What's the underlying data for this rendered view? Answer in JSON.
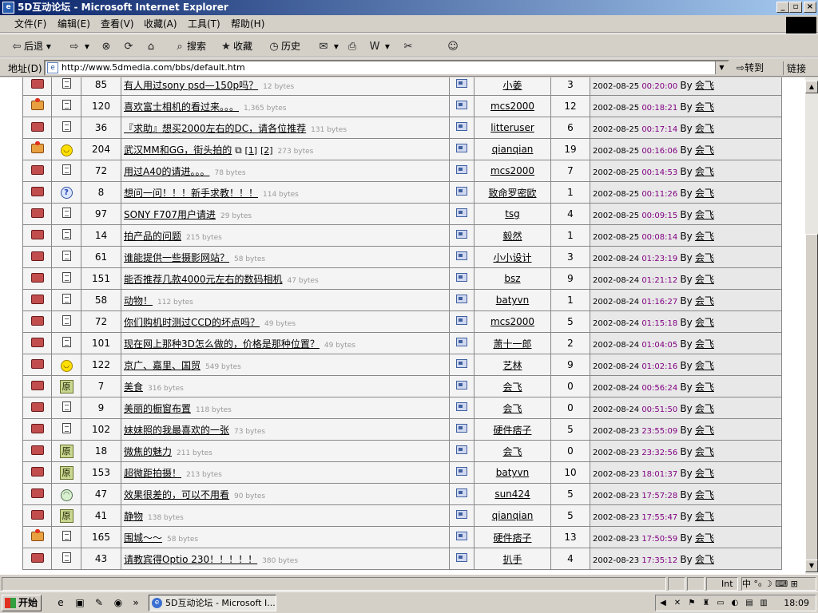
{
  "window": {
    "title": "5D互动论坛 - Microsoft Internet Explorer"
  },
  "menu": [
    "文件(F)",
    "编辑(E)",
    "查看(V)",
    "收藏(A)",
    "工具(T)",
    "帮助(H)"
  ],
  "toolbar": {
    "back": "后退",
    "search": "搜索",
    "favorites": "收藏",
    "history": "历史"
  },
  "address": {
    "label": "地址(D)",
    "url": "http://www.5dmedia.com/bbs/default.htm",
    "go": "转到",
    "links": "链接"
  },
  "colors": {
    "visited_time": "#800080",
    "bytes": "#999999",
    "title_bar": "#0a246a"
  },
  "rows": [
    {
      "folder": "normal",
      "emoticon": "doc",
      "replies": "85",
      "title": "有人用过sony psd—150p吗？",
      "bytes": "12 bytes",
      "author": "小姜",
      "views": "3",
      "date": "2002-08-25",
      "time": "00:20:00",
      "by": "By",
      "lastby": "会飞"
    },
    {
      "folder": "hot",
      "emoticon": "doc",
      "replies": "120",
      "title": "喜欢富士相机的看过来。。。",
      "bytes": "1,365 bytes",
      "author": "mcs2000",
      "views": "12",
      "date": "2002-08-25",
      "time": "00:18:21",
      "by": "By",
      "lastby": "会飞"
    },
    {
      "folder": "normal",
      "emoticon": "doc",
      "replies": "36",
      "title": "『求助』想买2000左右的DC，请各位推荐",
      "bytes": "131 bytes",
      "author": "litteruser",
      "views": "6",
      "date": "2002-08-25",
      "time": "00:17:14",
      "by": "By",
      "lastby": "会飞"
    },
    {
      "folder": "hot",
      "emoticon": "smile",
      "replies": "204",
      "title": "武汉MM和GG，街头拍的",
      "pages": [
        "[1]",
        "[2]"
      ],
      "bytes": "273 bytes",
      "author": "qianqian",
      "views": "19",
      "date": "2002-08-25",
      "time": "00:16:06",
      "by": "By",
      "lastby": "会飞"
    },
    {
      "folder": "normal",
      "emoticon": "doc",
      "replies": "72",
      "title": "用过A40的请进。。。",
      "bytes": "78 bytes",
      "author": "mcs2000",
      "views": "7",
      "date": "2002-08-25",
      "time": "00:14:53",
      "by": "By",
      "lastby": "会飞"
    },
    {
      "folder": "normal",
      "emoticon": "question",
      "replies": "8",
      "title": "想问一问！！！新手求教！！！",
      "bytes": "114 bytes",
      "author": "致命罗密欧",
      "views": "1",
      "date": "2002-08-25",
      "time": "00:11:26",
      "by": "By",
      "lastby": "会飞"
    },
    {
      "folder": "normal",
      "emoticon": "doc",
      "replies": "97",
      "title": "SONY F707用户请进",
      "bytes": "29 bytes",
      "author": "tsg",
      "views": "4",
      "date": "2002-08-25",
      "time": "00:09:15",
      "by": "By",
      "lastby": "会飞"
    },
    {
      "folder": "normal",
      "emoticon": "doc",
      "replies": "14",
      "title": "拍产品的问题",
      "bytes": "215 bytes",
      "author": "毅然",
      "views": "1",
      "date": "2002-08-25",
      "time": "00:08:14",
      "by": "By",
      "lastby": "会飞"
    },
    {
      "folder": "normal",
      "emoticon": "doc",
      "replies": "61",
      "title": "谁能提供一些摄影网站？",
      "bytes": "58 bytes",
      "author": "小小设计",
      "views": "3",
      "date": "2002-08-24",
      "time": "01:23:19",
      "by": "By",
      "lastby": "会飞"
    },
    {
      "folder": "normal",
      "emoticon": "doc",
      "replies": "151",
      "title": "能否推荐几款4000元左右的数码相机",
      "bytes": "47 bytes",
      "author": "bsz",
      "views": "9",
      "date": "2002-08-24",
      "time": "01:21:12",
      "by": "By",
      "lastby": "会飞"
    },
    {
      "folder": "normal",
      "emoticon": "doc",
      "replies": "58",
      "title": "动物！",
      "bytes": "112 bytes",
      "author": "batyvn",
      "views": "1",
      "date": "2002-08-24",
      "time": "01:16:27",
      "by": "By",
      "lastby": "会飞"
    },
    {
      "folder": "normal",
      "emoticon": "doc",
      "replies": "72",
      "title": "你们购机时测过CCD的坏点吗？",
      "bytes": "49 bytes",
      "author": "mcs2000",
      "views": "5",
      "date": "2002-08-24",
      "time": "01:15:18",
      "by": "By",
      "lastby": "会飞"
    },
    {
      "folder": "normal",
      "emoticon": "doc",
      "replies": "101",
      "title": "现在网上那种3D怎么做的，价格是那种位置？",
      "bytes": "49 bytes",
      "author": "萧十一郎",
      "views": "2",
      "date": "2002-08-24",
      "time": "01:04:05",
      "by": "By",
      "lastby": "会飞"
    },
    {
      "folder": "normal",
      "emoticon": "smile",
      "replies": "122",
      "title": "京广、嘉里、国贸",
      "bytes": "549 bytes",
      "author": "艺林",
      "views": "9",
      "date": "2002-08-24",
      "time": "01:02:16",
      "by": "By",
      "lastby": "会飞"
    },
    {
      "folder": "normal",
      "emoticon": "yuan",
      "replies": "7",
      "title": "美食",
      "bytes": "316 bytes",
      "author": "会飞",
      "views": "0",
      "date": "2002-08-24",
      "time": "00:56:24",
      "by": "By",
      "lastby": "会飞"
    },
    {
      "folder": "normal",
      "emoticon": "doc",
      "replies": "9",
      "title": "美丽的橱窗布置",
      "bytes": "118 bytes",
      "author": "会飞",
      "views": "0",
      "date": "2002-08-24",
      "time": "00:51:50",
      "by": "By",
      "lastby": "会飞"
    },
    {
      "folder": "normal",
      "emoticon": "doc",
      "replies": "102",
      "title": "妹妹照的我最喜欢的一张",
      "bytes": "73 bytes",
      "author": "硬件痞子",
      "views": "5",
      "date": "2002-08-23",
      "time": "23:55:09",
      "by": "By",
      "lastby": "会飞"
    },
    {
      "folder": "normal",
      "emoticon": "yuan",
      "replies": "18",
      "title": "微焦的魅力",
      "bytes": "211 bytes",
      "author": "会飞",
      "views": "0",
      "date": "2002-08-23",
      "time": "23:32:56",
      "by": "By",
      "lastby": "会飞"
    },
    {
      "folder": "normal",
      "emoticon": "yuan",
      "replies": "153",
      "title": "超微距拍摄！",
      "bytes": "213 bytes",
      "author": "batyvn",
      "views": "10",
      "date": "2002-08-23",
      "time": "18:01:37",
      "by": "By",
      "lastby": "会飞"
    },
    {
      "folder": "normal",
      "emoticon": "sad",
      "replies": "47",
      "title": "效果很差的，可以不用看",
      "bytes": "90 bytes",
      "author": "sun424",
      "views": "5",
      "date": "2002-08-23",
      "time": "17:57:28",
      "by": "By",
      "lastby": "会飞"
    },
    {
      "folder": "normal",
      "emoticon": "yuan",
      "replies": "41",
      "title": "静物",
      "bytes": "138 bytes",
      "author": "qianqian",
      "views": "5",
      "date": "2002-08-23",
      "time": "17:55:47",
      "by": "By",
      "lastby": "会飞"
    },
    {
      "folder": "hot",
      "emoticon": "doc",
      "replies": "165",
      "title": "围城～～",
      "bytes": "58 bytes",
      "author": "硬件痞子",
      "views": "13",
      "date": "2002-08-23",
      "time": "17:50:59",
      "by": "By",
      "lastby": "会飞"
    },
    {
      "folder": "normal",
      "emoticon": "doc",
      "replies": "43",
      "title": "请教宾得Optio 230！！！！！",
      "bytes": "380 bytes",
      "author": "扒手",
      "views": "4",
      "date": "2002-08-23",
      "time": "17:35:12",
      "by": "By",
      "lastby": "会飞"
    }
  ],
  "status": {
    "zone": "Int"
  },
  "taskbar": {
    "start": "开始",
    "item": "5D互动论坛 - Microsoft I...",
    "clock": "18:09"
  },
  "icons": [
    "ie-icon",
    "back-icon",
    "forward-icon",
    "stop-icon",
    "refresh-icon",
    "home-icon",
    "search-icon",
    "favorites-icon",
    "history-icon",
    "mail-icon",
    "print-icon",
    "edit-icon",
    "messenger-icon",
    "windows-logo-icon"
  ]
}
